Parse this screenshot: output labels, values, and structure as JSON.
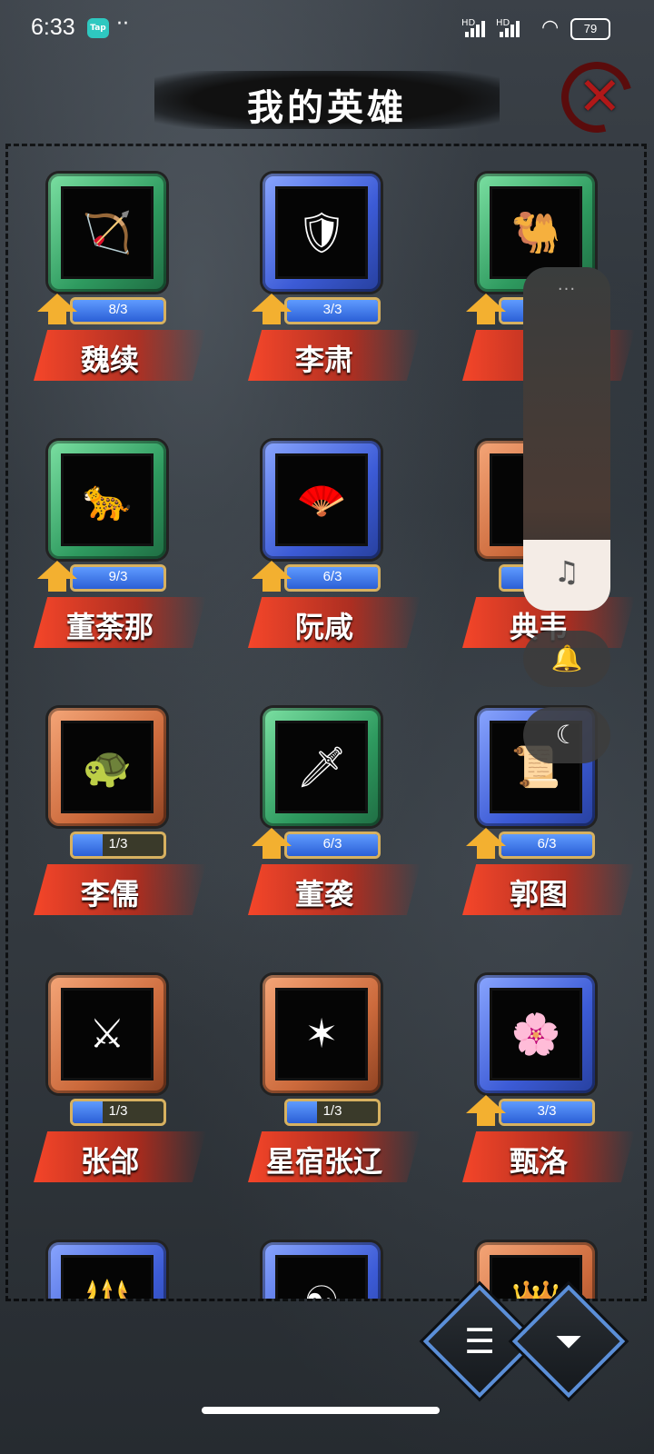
{
  "status_bar": {
    "time": "6:33",
    "app_icon_label": "Tap",
    "more_dots": "··",
    "signal1": "HD",
    "signal2": "HD",
    "battery": "79"
  },
  "header": {
    "title": "我的英雄"
  },
  "heroes": [
    {
      "name": "魏续",
      "progress": "8/3",
      "fill": 1.0,
      "frame": "green",
      "upgradable": true,
      "icon": "archer-icon"
    },
    {
      "name": "李肃",
      "progress": "3/3",
      "fill": 1.0,
      "frame": "blue",
      "upgradable": true,
      "icon": "armored-general-icon"
    },
    {
      "name": "孑",
      "progress": "",
      "fill": 1.0,
      "frame": "green",
      "upgradable": true,
      "icon": "camel-rider-icon"
    },
    {
      "name": "董荼那",
      "progress": "9/3",
      "fill": 1.0,
      "frame": "green",
      "upgradable": true,
      "icon": "leopard-shield-icon"
    },
    {
      "name": "阮咸",
      "progress": "6/3",
      "fill": 1.0,
      "frame": "blue",
      "upgradable": true,
      "icon": "fan-scholar-icon"
    },
    {
      "name": "典韦",
      "progress": "",
      "fill": 1.0,
      "frame": "orange",
      "upgradable": false,
      "icon": "warrior-icon"
    },
    {
      "name": "李儒",
      "progress": "1/3",
      "fill": 0.33,
      "frame": "orange",
      "upgradable": false,
      "icon": "turtle-rider-icon"
    },
    {
      "name": "董袭",
      "progress": "6/3",
      "fill": 1.0,
      "frame": "green",
      "upgradable": true,
      "icon": "swordsman-icon"
    },
    {
      "name": "郭图",
      "progress": "6/3",
      "fill": 1.0,
      "frame": "blue",
      "upgradable": true,
      "icon": "strategist-icon"
    },
    {
      "name": "张郃",
      "progress": "1/3",
      "fill": 0.33,
      "frame": "orange",
      "upgradable": false,
      "icon": "dual-blade-icon"
    },
    {
      "name": "星宿张辽",
      "progress": "1/3",
      "fill": 0.33,
      "frame": "orange",
      "upgradable": false,
      "icon": "star-general-icon"
    },
    {
      "name": "甄洛",
      "progress": "3/3",
      "fill": 1.0,
      "frame": "blue",
      "upgradable": true,
      "icon": "lady-fan-icon"
    },
    {
      "name": "",
      "progress": "",
      "fill": 0,
      "frame": "blue",
      "upgradable": false,
      "icon": "spearman-icon"
    },
    {
      "name": "",
      "progress": "",
      "fill": 0,
      "frame": "blue",
      "upgradable": false,
      "icon": "monk-icon"
    },
    {
      "name": "",
      "progress": "",
      "fill": 0,
      "frame": "orange",
      "upgradable": false,
      "icon": "golden-general-icon"
    }
  ],
  "floating": {
    "handle": "···",
    "music_icon": "♫",
    "bell_icon": "🔔",
    "moon_icon": "☾"
  },
  "bottom": {
    "list_icon": "☰",
    "filter_icon": "⏷"
  },
  "close_icon": "✕"
}
